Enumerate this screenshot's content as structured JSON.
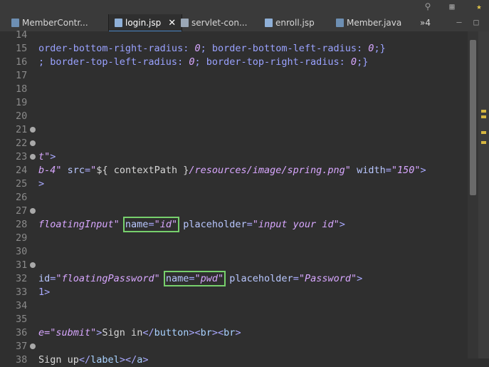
{
  "tabs": [
    {
      "label": "MemberContr...",
      "icon": "java-file-icon"
    },
    {
      "label": "login.jsp",
      "icon": "jsp-file-icon",
      "active": true
    },
    {
      "label": "servlet-con...",
      "icon": "xml-file-icon"
    },
    {
      "label": "enroll.jsp",
      "icon": "jsp-file-icon"
    },
    {
      "label": "Member.java",
      "icon": "java-file-icon"
    },
    {
      "label": "»4",
      "icon": "overflow-icon"
    }
  ],
  "editor": {
    "lines": [
      {
        "n": "14",
        "segs": []
      },
      {
        "n": "15",
        "segs": [
          [
            "cssv",
            "order-bottom-right-radius: "
          ],
          [
            "str",
            "0"
          ],
          [
            "cssv",
            "; border-bottom-left-radius: "
          ],
          [
            "str",
            "0"
          ],
          [
            "cssv",
            ";}"
          ]
        ]
      },
      {
        "n": "16",
        "segs": [
          [
            "cssv",
            "; border-top-left-radius: "
          ],
          [
            "str",
            "0"
          ],
          [
            "cssv",
            "; border-top-right-radius: "
          ],
          [
            "str",
            "0"
          ],
          [
            "cssv",
            ";}"
          ]
        ]
      },
      {
        "n": "17",
        "segs": []
      },
      {
        "n": "18",
        "segs": []
      },
      {
        "n": "19",
        "segs": []
      },
      {
        "n": "20",
        "segs": []
      },
      {
        "n": "21",
        "fold": true,
        "segs": []
      },
      {
        "n": "22",
        "fold": true,
        "segs": []
      },
      {
        "n": "23",
        "fold": true,
        "segs": [
          [
            "str",
            "t\""
          ],
          [
            "tag",
            ">"
          ]
        ]
      },
      {
        "n": "24",
        "segs": [
          [
            "str",
            "b-4\" "
          ],
          [
            "attr",
            "src"
          ],
          [
            "tag",
            "="
          ],
          [
            "str",
            "\""
          ],
          [
            "plain",
            "${ contextPath }"
          ],
          [
            "str",
            "/resources/image/spring.png\" "
          ],
          [
            "attr",
            "width"
          ],
          [
            "tag",
            "="
          ],
          [
            "str",
            "\"150\""
          ],
          [
            "tag",
            ">"
          ]
        ]
      },
      {
        "n": "25",
        "segs": [
          [
            "tag",
            ">"
          ]
        ]
      },
      {
        "n": "26",
        "segs": []
      },
      {
        "n": "27",
        "fold": true,
        "segs": []
      },
      {
        "n": "28",
        "segs": [
          [
            "str",
            "floatingInput\" "
          ],
          [
            "hl",
            [
              [
                "attr",
                "name"
              ],
              [
                "tag",
                "="
              ],
              [
                "str",
                "\"id\""
              ]
            ]
          ],
          [
            "plain",
            " "
          ],
          [
            "attr",
            "placeholder"
          ],
          [
            "tag",
            "="
          ],
          [
            "str",
            "\"input your id\""
          ],
          [
            "tag",
            ">"
          ]
        ]
      },
      {
        "n": "29",
        "segs": []
      },
      {
        "n": "30",
        "segs": []
      },
      {
        "n": "31",
        "fold": true,
        "segs": []
      },
      {
        "n": "32",
        "segs": [
          [
            "attr",
            "id"
          ],
          [
            "tag",
            "="
          ],
          [
            "str",
            "\"floatingPassword\" "
          ],
          [
            "hl",
            [
              [
                "attr",
                "name"
              ],
              [
                "tag",
                "="
              ],
              [
                "str",
                "\"pwd\""
              ]
            ]
          ],
          [
            "plain",
            " "
          ],
          [
            "attr",
            "placeholder"
          ],
          [
            "tag",
            "="
          ],
          [
            "str",
            "\"Password\""
          ],
          [
            "tag",
            ">"
          ]
        ]
      },
      {
        "n": "33",
        "segs": [
          [
            "tag",
            "1>"
          ]
        ]
      },
      {
        "n": "34",
        "segs": []
      },
      {
        "n": "35",
        "segs": []
      },
      {
        "n": "36",
        "segs": [
          [
            "str",
            "e=\"submit\""
          ],
          [
            "tag",
            ">"
          ],
          [
            "plain",
            "Sign in"
          ],
          [
            "tag",
            "</"
          ],
          [
            "kw",
            "button"
          ],
          [
            "tag",
            "><"
          ],
          [
            "kw",
            "br"
          ],
          [
            "tag",
            "><"
          ],
          [
            "kw",
            "br"
          ],
          [
            "tag",
            ">"
          ]
        ]
      },
      {
        "n": "37",
        "fold": true,
        "segs": []
      },
      {
        "n": "38",
        "segs": [
          [
            "plain",
            "Sign up"
          ],
          [
            "tag",
            "</"
          ],
          [
            "kw",
            "label"
          ],
          [
            "tag",
            "></"
          ],
          [
            "kw",
            "a"
          ],
          [
            "tag",
            ">"
          ]
        ]
      }
    ]
  }
}
